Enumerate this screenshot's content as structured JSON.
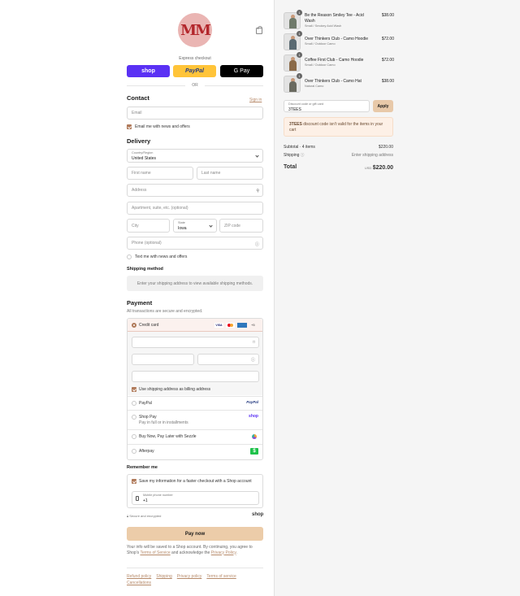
{
  "brand": {
    "logo_text": "MM"
  },
  "express": {
    "label": "Express checkout",
    "shop_label": "shop",
    "paypal_label": "PayPal",
    "gpay_label": "G Pay",
    "or_label": "OR"
  },
  "contact": {
    "title": "Contact",
    "signin": "Sign in",
    "email_placeholder": "Email",
    "news_label": "Email me with news and offers"
  },
  "delivery": {
    "title": "Delivery",
    "country_label": "Country/Region",
    "country_value": "United States",
    "first_name": "First name",
    "last_name": "Last name",
    "address": "Address",
    "apartment": "Apartment, suite, etc. (optional)",
    "city": "City",
    "state_label": "State",
    "state_value": "Iowa",
    "zip": "ZIP code",
    "phone": "Phone (optional)",
    "text_news": "Text me with news and offers"
  },
  "shipping_method": {
    "title": "Shipping method",
    "message": "Enter your shipping address to view available shipping methods."
  },
  "payment": {
    "title": "Payment",
    "subtitle": "All transactions are secure and encrypted.",
    "credit_card": "Credit card",
    "card_more": "+5",
    "billing_same": "Use shipping address as billing address",
    "paypal": "PayPal",
    "paypal_logo": "PayPal",
    "shop_pay": "Shop Pay",
    "shop_pay_sub": "Pay in full or in installments",
    "shop_logo": "shop",
    "sezzle": "Buy Now, Pay Later with Sezzle",
    "afterpay": "Afterpay"
  },
  "remember": {
    "title": "Remember me",
    "save_label": "Save my information for a faster checkout with a Shop account",
    "mobile_label": "Mobile phone number",
    "mobile_value": "+1",
    "secure_label": "Secure and encrypted",
    "shop_logo": "shop"
  },
  "pay_now": "Pay now",
  "terms": {
    "text_1": "Your info will be saved to a Shop account. By continuing, you agree to Shop's ",
    "tos": "Terms of Service",
    "text_2": " and acknowledge the ",
    "privacy": "Privacy Policy",
    "text_3": "."
  },
  "footer": {
    "links": [
      "Refund policy",
      "Shipping",
      "Privacy policy",
      "Terms of service",
      "Cancellations"
    ]
  },
  "cart": {
    "items": [
      {
        "name": "Be the Reason Smiley Tee - Acid Wash",
        "variant": "Small / Smokey Acid Wash",
        "price": "$38.00",
        "qty": "1",
        "color": "#6f7a6a"
      },
      {
        "name": "Over Thinkers Club - Camo Hoodie",
        "variant": "Small / Outdoor Camo",
        "price": "$72.00",
        "qty": "1",
        "color": "#5a6a72"
      },
      {
        "name": "Coffee First Club - Camo Hoodie",
        "variant": "Small / Outdoor Camo",
        "price": "$72.00",
        "qty": "1",
        "color": "#8a6a48"
      },
      {
        "name": "Over Thinkers Club - Camo Hat",
        "variant": "Natural Camo",
        "price": "$38.00",
        "qty": "1",
        "color": "#6a6a60"
      }
    ],
    "discount_label": "Discount code or gift card",
    "discount_value": "3TEES",
    "apply": "Apply",
    "warning_code": "3TEES",
    "warning_text": " discount code isn't valid for the items in your cart",
    "subtotal_label": "Subtotal · 4 items",
    "subtotal_value": "$220.00",
    "shipping_label": "Shipping",
    "shipping_value": "Enter shipping address",
    "total_label": "Total",
    "currency": "USD",
    "total_value": "$220.00"
  },
  "colors": {
    "accent": "#b07a5a",
    "pay_button": "#eccca9",
    "shop_purple": "#5a31f4",
    "paypal_yellow": "#ffc439"
  }
}
